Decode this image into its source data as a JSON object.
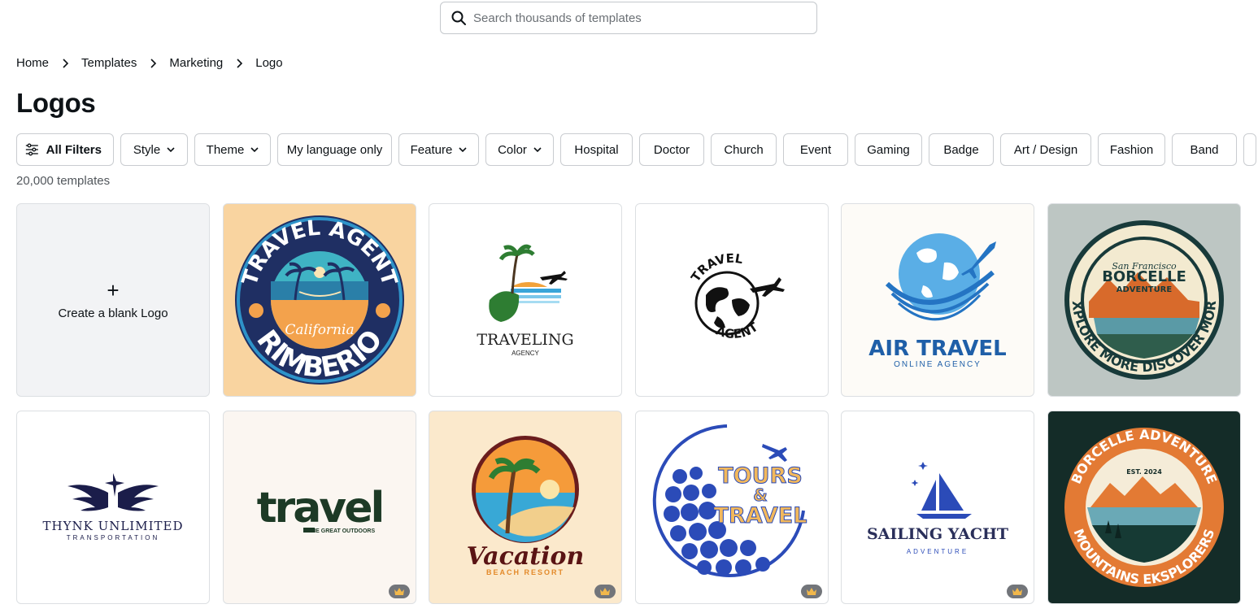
{
  "search": {
    "placeholder": "Search thousands of templates"
  },
  "breadcrumb": [
    "Home",
    "Templates",
    "Marketing",
    "Logo"
  ],
  "page_title": "Logos",
  "filters": {
    "all": "All Filters",
    "style": "Style",
    "theme": "Theme",
    "language": "My language only",
    "feature": "Feature",
    "color": "Color",
    "hospital": "Hospital",
    "doctor": "Doctor",
    "church": "Church",
    "event": "Event",
    "gaming": "Gaming",
    "badge": "Badge",
    "art_design": "Art / Design",
    "fashion": "Fashion",
    "band": "Band"
  },
  "template_count": "20,000 templates",
  "blank_card": {
    "icon": "plus-icon",
    "label": "Create a blank Logo"
  },
  "templates": {
    "t1": {
      "top": "TRAVEL AGENT",
      "script": "California",
      "bottom": "RIMBERIO",
      "bg": "#f9d4a0"
    },
    "t2": {
      "title": "TRAVELING",
      "sub": "AGENCY"
    },
    "t3": {
      "top": "TRAVEL",
      "bottom": "AGENT"
    },
    "t4": {
      "title": "AIR TRAVEL",
      "sub": "ONLINE AGENCY",
      "color": "#1f5fa8"
    },
    "t5": {
      "top": "San Francisco",
      "title": "BORCELLE",
      "sub": "ADVENTURE",
      "ring": "EXPLORE MORE DISCOVER MORE",
      "bg": "#bdc6c3"
    },
    "t6": {
      "title": "THYNK UNLIMITED",
      "sub": "TRANSPORTATION"
    },
    "t7": {
      "title": "travel",
      "sub": "THE GREAT OUTDOORS",
      "bg": "#fbf6f1"
    },
    "t8": {
      "title": "Vacation",
      "sub": "BEACH RESORT",
      "bg": "#fbe9cc"
    },
    "t9": {
      "line1": "TOURS",
      "amp": "&",
      "line2": "TRAVEL"
    },
    "t10": {
      "title": "SAILING YACHT",
      "sub": "ADVENTURE"
    },
    "t11": {
      "top": "BORCELLE ADVENTURE",
      "est": "EST. 2024",
      "bottom": "MOUNTAINS EKSPLORERS",
      "bg": "#142c28"
    }
  },
  "premium_icon": "crown-icon"
}
